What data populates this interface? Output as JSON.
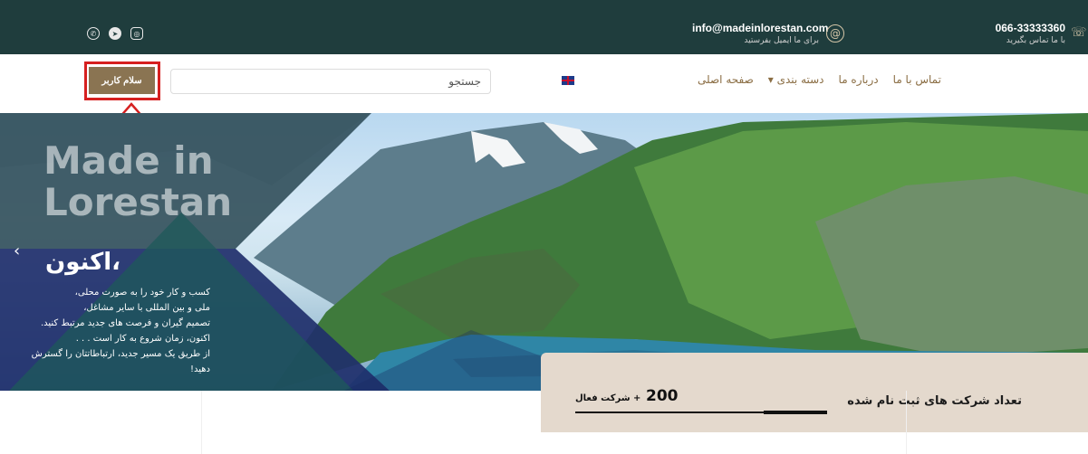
{
  "topbar": {
    "phone": "066-33333360",
    "phone_sub": "با ما تماس بگیرید",
    "email": "info@madeinlorestan.com",
    "email_sub": "برای ما ایمیل بفرستید",
    "social_icons": [
      "whatsapp-icon",
      "telegram-icon",
      "instagram-icon"
    ]
  },
  "nav": {
    "menu": [
      "صفحه اصلی",
      "دسته بندی ▾",
      "درباره ما",
      "تماس با ما"
    ],
    "search_placeholder": "جستجو",
    "login_label": "سلام کاربر"
  },
  "hero": {
    "title_line1": "Made in",
    "title_line2": "Lorestan",
    "subtitle": "اکنون،",
    "lines": [
      "کسب و کار خود را به صورت محلی،",
      "ملی و بین المللی با سایر مشاغل،",
      "تصمیم گیران و فرصت های جدید مرتبط کنید.",
      "اکنون، زمان شروع به کار است . . .",
      "از طریق یک مسیر جدید، ارتباطاتتان را گسترش دهید!"
    ]
  },
  "stats": {
    "label": "تعداد شرکت های ثبت نام شده",
    "count": "200",
    "count_suffix": "+ شرکت فعال"
  },
  "colors": {
    "topbar_bg": "#1f3d3d",
    "accent_gold": "#8a6d43",
    "button_bg": "#8a7452",
    "highlight": "#d62020",
    "stats_bg": "#e4d9cd"
  }
}
